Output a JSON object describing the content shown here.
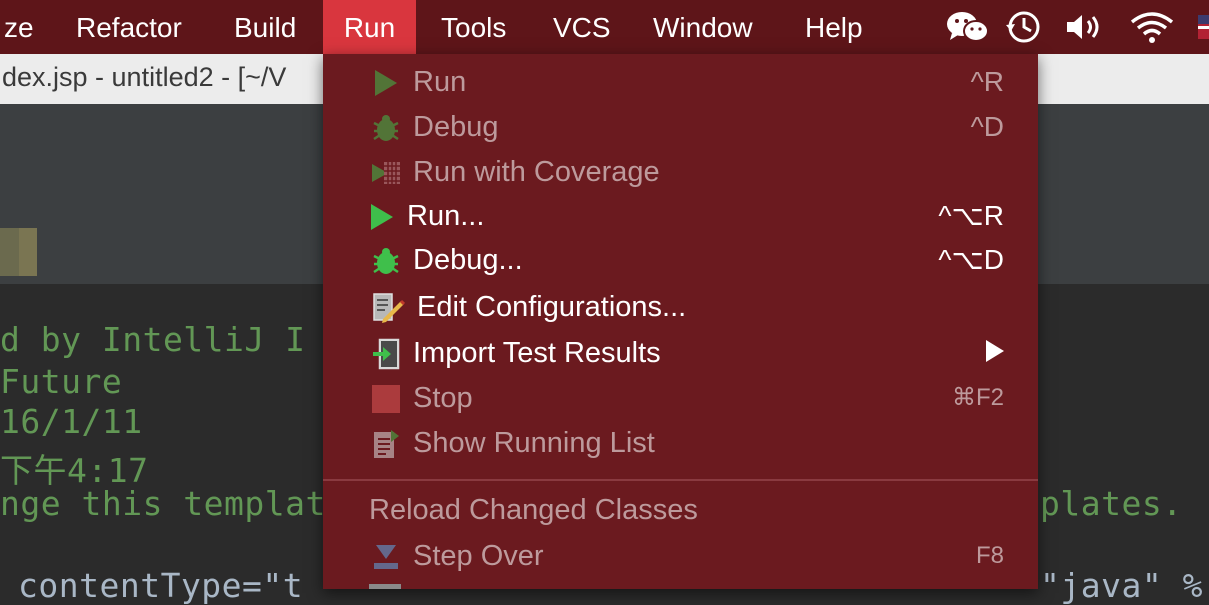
{
  "menubar": {
    "items": [
      "ze",
      "Refactor",
      "Build",
      "Run",
      "Tools",
      "VCS",
      "Window",
      "Help"
    ],
    "active": "Run",
    "tray": [
      "wechat-icon",
      "time-machine-icon",
      "volume-icon",
      "wifi-icon",
      "flag-icon"
    ]
  },
  "window": {
    "title": "dex.jsp - untitled2 - [~/V"
  },
  "editor": {
    "lines": [
      "d by IntelliJ I",
      "Future",
      "16/1/11",
      "下午4:17",
      "nge this templat",
      "contentType=\"t"
    ],
    "right_text_1": "plates.",
    "right_text_2": "\"java\" %"
  },
  "run_menu": {
    "items": [
      {
        "label": "Run",
        "shortcut": "^R",
        "enabled": false,
        "icon": "run-icon"
      },
      {
        "label": "Debug",
        "shortcut": "^D",
        "enabled": false,
        "icon": "debug-icon"
      },
      {
        "label": "Run with Coverage",
        "shortcut": "",
        "enabled": false,
        "icon": "coverage-icon"
      },
      {
        "label": "Run...",
        "shortcut": "^⌥R",
        "enabled": true,
        "icon": "run-icon"
      },
      {
        "label": "Debug...",
        "shortcut": "^⌥D",
        "enabled": true,
        "icon": "debug-icon"
      },
      {
        "label": "Edit Configurations...",
        "shortcut": "",
        "enabled": true,
        "icon": "edit-config-icon"
      },
      {
        "label": "Import Test Results",
        "shortcut": "",
        "enabled": true,
        "icon": "import-icon",
        "submenu": true
      },
      {
        "label": "Stop",
        "shortcut": "⌘F2",
        "enabled": false,
        "icon": "stop-icon"
      },
      {
        "label": "Show Running List",
        "shortcut": "",
        "enabled": false,
        "icon": "running-list-icon"
      }
    ],
    "section_header": "Reload Changed Classes",
    "step_over": {
      "label": "Step Over",
      "shortcut": "F8",
      "enabled": false,
      "icon": "step-over-icon"
    }
  },
  "colors": {
    "menubar_bg": "#5e1519",
    "menubar_active": "#d9363e",
    "menu_bg": "#6b1a1f",
    "disabled_text": "#bd9a9c",
    "run_green": "#3fbf4b",
    "editor_bg": "#2b2b2b"
  }
}
